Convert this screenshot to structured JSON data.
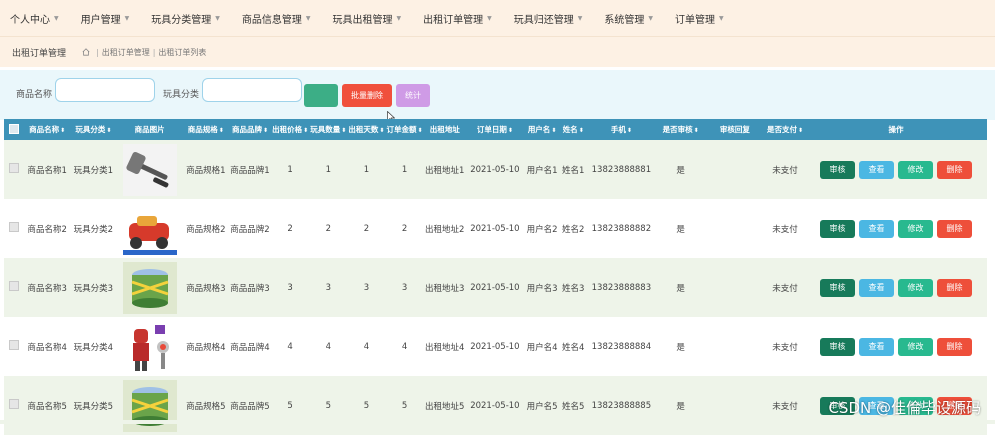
{
  "nav": [
    "个人中心",
    "用户管理",
    "玩具分类管理",
    "商品信息管理",
    "玩具出租管理",
    "出租订单管理",
    "玩具归还管理",
    "系统管理",
    "订单管理"
  ],
  "subbar": {
    "title": "出租订单管理",
    "crumbs": [
      "出租订单管理",
      "出租订单列表"
    ]
  },
  "search": {
    "name_label": "商品名称",
    "category_label": "玩具分类",
    "name_value": "",
    "category_value": "",
    "search_label": "",
    "batch_delete_label": "批量删除",
    "stats_label": "统计"
  },
  "columns": [
    "商品名称",
    "玩具分类",
    "商品图片",
    "商品规格",
    "商品品牌",
    "出租价格",
    "玩具数量",
    "出租天数",
    "订单金额",
    "出租地址",
    "订单日期",
    "用户名",
    "姓名",
    "手机",
    "是否审核",
    "审核回复",
    "是否支付",
    "操作"
  ],
  "sortable": [
    true,
    true,
    false,
    true,
    true,
    true,
    true,
    true,
    true,
    false,
    true,
    true,
    true,
    true,
    true,
    false,
    true,
    false
  ],
  "rows": [
    {
      "name": "商品名称1",
      "category": "玩具分类1",
      "image": "hammer-toy",
      "spec": "商品规格1",
      "brand": "商品品牌1",
      "price": "1",
      "qty": "1",
      "days": "1",
      "amount": "1",
      "addr": "出租地址1",
      "date": "2021-05-10",
      "user": "用户名1",
      "real": "姓名1",
      "phone": "13823888881",
      "audit": "是",
      "reply": "",
      "paid": "未支付"
    },
    {
      "name": "商品名称2",
      "category": "玩具分类2",
      "image": "toy-car",
      "spec": "商品规格2",
      "brand": "商品品牌2",
      "price": "2",
      "qty": "2",
      "days": "2",
      "amount": "2",
      "addr": "出租地址2",
      "date": "2021-05-10",
      "user": "用户名2",
      "real": "姓名2",
      "phone": "13823888882",
      "audit": "是",
      "reply": "",
      "paid": "未支付"
    },
    {
      "name": "商品名称3",
      "category": "玩具分类3",
      "image": "toy-drum",
      "spec": "商品规格3",
      "brand": "商品品牌3",
      "price": "3",
      "qty": "3",
      "days": "3",
      "amount": "3",
      "addr": "出租地址3",
      "date": "2021-05-10",
      "user": "用户名3",
      "real": "姓名3",
      "phone": "13823888883",
      "audit": "是",
      "reply": "",
      "paid": "未支付"
    },
    {
      "name": "商品名称4",
      "category": "玩具分类4",
      "image": "robot-toy",
      "spec": "商品规格4",
      "brand": "商品品牌4",
      "price": "4",
      "qty": "4",
      "days": "4",
      "amount": "4",
      "addr": "出租地址4",
      "date": "2021-05-10",
      "user": "用户名4",
      "real": "姓名4",
      "phone": "13823888884",
      "audit": "是",
      "reply": "",
      "paid": "未支付"
    },
    {
      "name": "商品名称5",
      "category": "玩具分类5",
      "image": "toy-drum",
      "spec": "商品规格5",
      "brand": "商品品牌5",
      "price": "5",
      "qty": "5",
      "days": "5",
      "amount": "5",
      "addr": "出租地址5",
      "date": "2021-05-10",
      "user": "用户名5",
      "real": "姓名5",
      "phone": "13823888885",
      "audit": "是",
      "reply": "",
      "paid": "未支付"
    }
  ],
  "actions": [
    "审核",
    "查看",
    "修改",
    "删除"
  ],
  "watermark": "CSDN @佳倫毕设源码",
  "colors": {
    "nav_bg": "#fdf1e4",
    "header_bg": "#3e93b8",
    "row_alt": "#eef4e9",
    "audit": "#177a5a",
    "view": "#4bb7e3",
    "edit": "#28b98f",
    "delete": "#ee4f3a"
  }
}
